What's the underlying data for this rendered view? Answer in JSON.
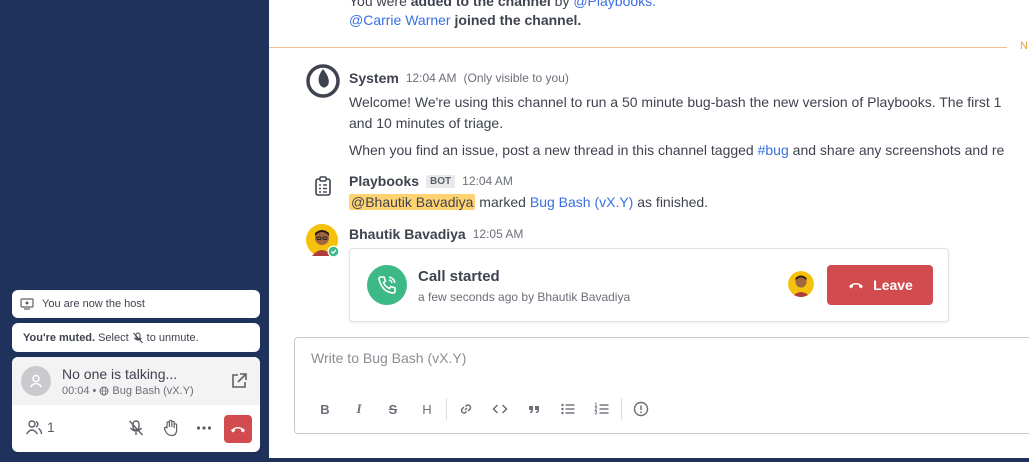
{
  "sidebar": {
    "toast_host": "You are now the host",
    "toast_muted_bold": "You're muted.",
    "toast_muted_rest": "Select",
    "toast_muted_end": "to unmute.",
    "call_widget": {
      "talking": "No one is talking...",
      "duration": "00:04",
      "separator": "•",
      "channel": "Bug Bash (vX.Y)",
      "participants_count": "1"
    }
  },
  "channel": {
    "intro_line1_prefix": "You were",
    "intro_line1_bold": "added to the channel",
    "intro_line1_by": "by",
    "intro_line1_link": "@Playbooks.",
    "intro_line2_link": "@Carrie Warner",
    "intro_line2_bold": "joined the channel.",
    "new_label": "N"
  },
  "posts": {
    "system": {
      "author": "System",
      "time": "12:04 AM",
      "visibility": "(Only visible to you)",
      "line1": "Welcome! We're using this channel to run a 50 minute bug-bash the new version of Playbooks. The first 1",
      "line2": "and 10 minutes of triage.",
      "line3_prefix": "When you find an issue, post a new thread in this channel tagged",
      "line3_tag": "#bug",
      "line3_suffix": "and share any screenshots and re"
    },
    "playbooks": {
      "author": "Playbooks",
      "badge": "BOT",
      "time": "12:04 AM",
      "mention": "@Bhautik Bavadiya",
      "text_mid": "marked",
      "link": "Bug Bash (vX.Y)",
      "text_end": "as finished."
    },
    "bhautik": {
      "author": "Bhautik Bavadiya",
      "time": "12:05 AM",
      "call_title": "Call started",
      "call_sub": "a few seconds ago by Bhautik Bavadiya",
      "leave_label": "Leave"
    }
  },
  "composer": {
    "placeholder": "Write to Bug Bash (vX.Y)",
    "format_buttons": [
      "B",
      "I",
      "S",
      "H",
      "link",
      "code",
      "quote",
      "ul",
      "ol",
      "info"
    ]
  },
  "colors": {
    "sidebar_bg": "#1e325c",
    "link": "#386fe5",
    "danger": "#d24b4e",
    "success": "#3db887",
    "mention_highlight": "#ffd470",
    "new_messages": "#e8a047"
  }
}
